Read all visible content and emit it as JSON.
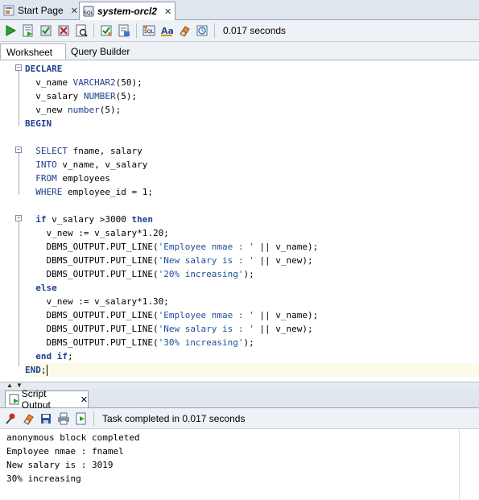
{
  "doc_tabs": [
    {
      "label": "Start Page",
      "close": "✕"
    },
    {
      "label": "system-orcl2",
      "close": "✕"
    }
  ],
  "toolbar": {
    "icons": [
      "run-icon",
      "run-script-icon",
      "commit-icon",
      "rollback-icon",
      "explain-plan-icon",
      "autotrace-icon",
      "sql-tuning-icon",
      "format-icon",
      "clear-icon",
      "history-icon"
    ],
    "timing": "0.017 seconds"
  },
  "worksheet_tabs": [
    "Worksheet",
    "Query Builder"
  ],
  "editor": {
    "lines": [
      [
        [
          "kw",
          "DECLARE"
        ]
      ],
      [
        [
          "",
          "  v_name "
        ],
        [
          "kw2",
          "VARCHAR2"
        ],
        [
          "",
          "(50);"
        ]
      ],
      [
        [
          "",
          "  v_salary "
        ],
        [
          "kw2",
          "NUMBER"
        ],
        [
          "",
          "(5);"
        ]
      ],
      [
        [
          "",
          "  v_new "
        ],
        [
          "kw2",
          "number"
        ],
        [
          "",
          "(5);"
        ]
      ],
      [
        [
          "kw",
          "BEGIN"
        ]
      ],
      [
        [
          "",
          ""
        ]
      ],
      [
        [
          "",
          "  "
        ],
        [
          "kw2",
          "SELECT"
        ],
        [
          "",
          " fname, salary"
        ]
      ],
      [
        [
          "",
          "  "
        ],
        [
          "kw2",
          "INTO"
        ],
        [
          "",
          " v_name, v_salary"
        ]
      ],
      [
        [
          "",
          "  "
        ],
        [
          "kw2",
          "FROM"
        ],
        [
          "",
          " employees"
        ]
      ],
      [
        [
          "",
          "  "
        ],
        [
          "kw2",
          "WHERE"
        ],
        [
          "",
          " employee_id = 1;"
        ]
      ],
      [
        [
          "",
          ""
        ]
      ],
      [
        [
          "",
          "  "
        ],
        [
          "kw",
          "if"
        ],
        [
          "",
          " v_salary >3000 "
        ],
        [
          "kw",
          "then"
        ]
      ],
      [
        [
          "",
          "    v_new := v_salary*1.20;"
        ]
      ],
      [
        [
          "",
          "    DBMS_OUTPUT.PUT_LINE("
        ],
        [
          "str",
          "'Employee nmae : '"
        ],
        [
          "",
          " || v_name);"
        ]
      ],
      [
        [
          "",
          "    DBMS_OUTPUT.PUT_LINE("
        ],
        [
          "str",
          "'New salary is : '"
        ],
        [
          "",
          " || v_new);"
        ]
      ],
      [
        [
          "",
          "    DBMS_OUTPUT.PUT_LINE("
        ],
        [
          "str",
          "'20% increasing'"
        ],
        [
          "",
          ");"
        ]
      ],
      [
        [
          "",
          "  "
        ],
        [
          "kw",
          "else"
        ]
      ],
      [
        [
          "",
          "    v_new := v_salary*1.30;"
        ]
      ],
      [
        [
          "",
          "    DBMS_OUTPUT.PUT_LINE("
        ],
        [
          "str",
          "'Employee nmae : '"
        ],
        [
          "",
          " || v_name);"
        ]
      ],
      [
        [
          "",
          "    DBMS_OUTPUT.PUT_LINE("
        ],
        [
          "str",
          "'New salary is : '"
        ],
        [
          "",
          " || v_new);"
        ]
      ],
      [
        [
          "",
          "    DBMS_OUTPUT.PUT_LINE("
        ],
        [
          "str",
          "'30% increasing'"
        ],
        [
          "",
          ");"
        ]
      ],
      [
        [
          "",
          "  "
        ],
        [
          "kw",
          "end if"
        ],
        [
          "",
          ";"
        ]
      ],
      [
        [
          "kw",
          "END"
        ],
        [
          "",
          ";"
        ]
      ]
    ]
  },
  "output_panel": {
    "tab_label": "Script Output",
    "tab_close": "✕",
    "status": "Task completed in 0.017 seconds",
    "lines": [
      "anonymous block completed",
      "Employee nmae : fnamel",
      "New salary is : 3019",
      "30% increasing"
    ]
  }
}
